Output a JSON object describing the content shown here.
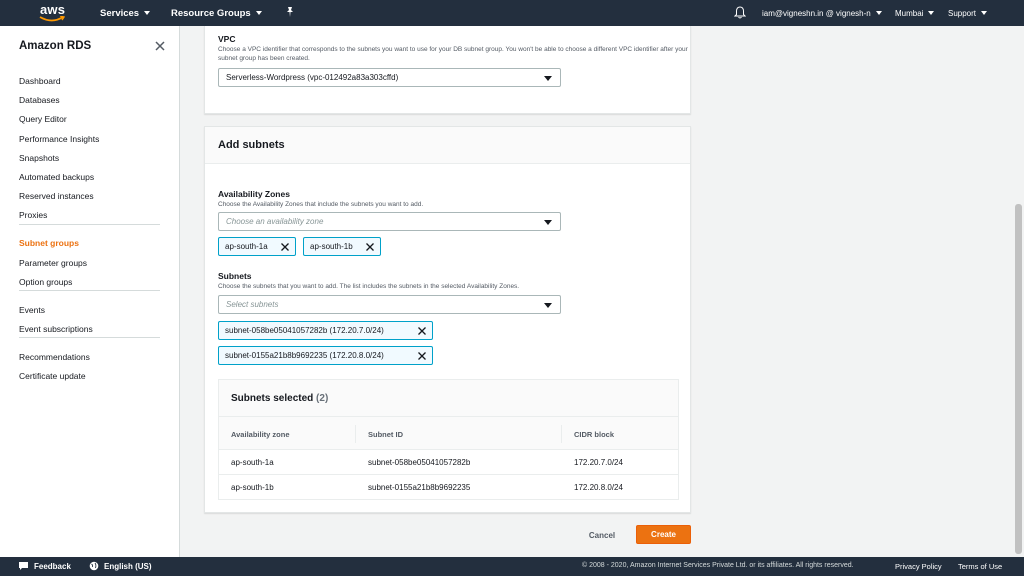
{
  "topnav": {
    "logo": "aws",
    "services": "Services",
    "resource_groups": "Resource Groups",
    "account": "iam@vigneshn.in @ vignesh-n",
    "region": "Mumbai",
    "support": "Support",
    "pin_icon": "pin-icon",
    "bell_icon": "bell-icon"
  },
  "sidebar": {
    "title": "Amazon RDS",
    "groups": [
      [
        "Dashboard",
        "Databases",
        "Query Editor",
        "Performance Insights",
        "Snapshots",
        "Automated backups",
        "Reserved instances",
        "Proxies"
      ],
      [
        "Subnet groups",
        "Parameter groups",
        "Option groups"
      ],
      [
        "Events",
        "Event subscriptions"
      ],
      [
        "Recommendations",
        "Certificate update"
      ]
    ],
    "active": "Subnet groups"
  },
  "vpc": {
    "label": "VPC",
    "hint": "Choose a VPC identifier that corresponds to the subnets you want to use for your DB subnet group. You won't be able to choose a different VPC identifier after your subnet group has been created.",
    "value": "Serverless-Wordpress (vpc-012492a83a303cffd)"
  },
  "add_subnets": {
    "title": "Add subnets",
    "az_label": "Availability Zones",
    "az_hint": "Choose the Availability Zones that include the subnets you want to add.",
    "az_placeholder": "Choose an availability zone",
    "az_tokens": [
      "ap-south-1a",
      "ap-south-1b"
    ],
    "subnets_label": "Subnets",
    "subnets_hint": "Choose the subnets that you want to add. The list includes the subnets in the selected Availability Zones.",
    "subnets_placeholder": "Select subnets",
    "subnet_tokens": [
      "subnet-058be05041057282b (172.20.7.0/24)",
      "subnet-0155a21b8b9692235 (172.20.8.0/24)"
    ]
  },
  "selected_table": {
    "title": "Subnets selected",
    "count": "(2)",
    "columns": [
      "Availability zone",
      "Subnet ID",
      "CIDR block"
    ],
    "rows": [
      [
        "ap-south-1a",
        "subnet-058be05041057282b",
        "172.20.7.0/24"
      ],
      [
        "ap-south-1b",
        "subnet-0155a21b8b9692235",
        "172.20.8.0/24"
      ]
    ]
  },
  "actions": {
    "cancel": "Cancel",
    "create": "Create"
  },
  "footer": {
    "feedback": "Feedback",
    "language": "English (US)",
    "copyright": "© 2008 - 2020, Amazon Internet Services Private Ltd. or its affiliates. All rights reserved.",
    "privacy": "Privacy Policy",
    "terms": "Terms of Use"
  },
  "colors": {
    "nav": "#232f3e",
    "accent": "#ec7211",
    "token_border": "#00a1c9"
  }
}
